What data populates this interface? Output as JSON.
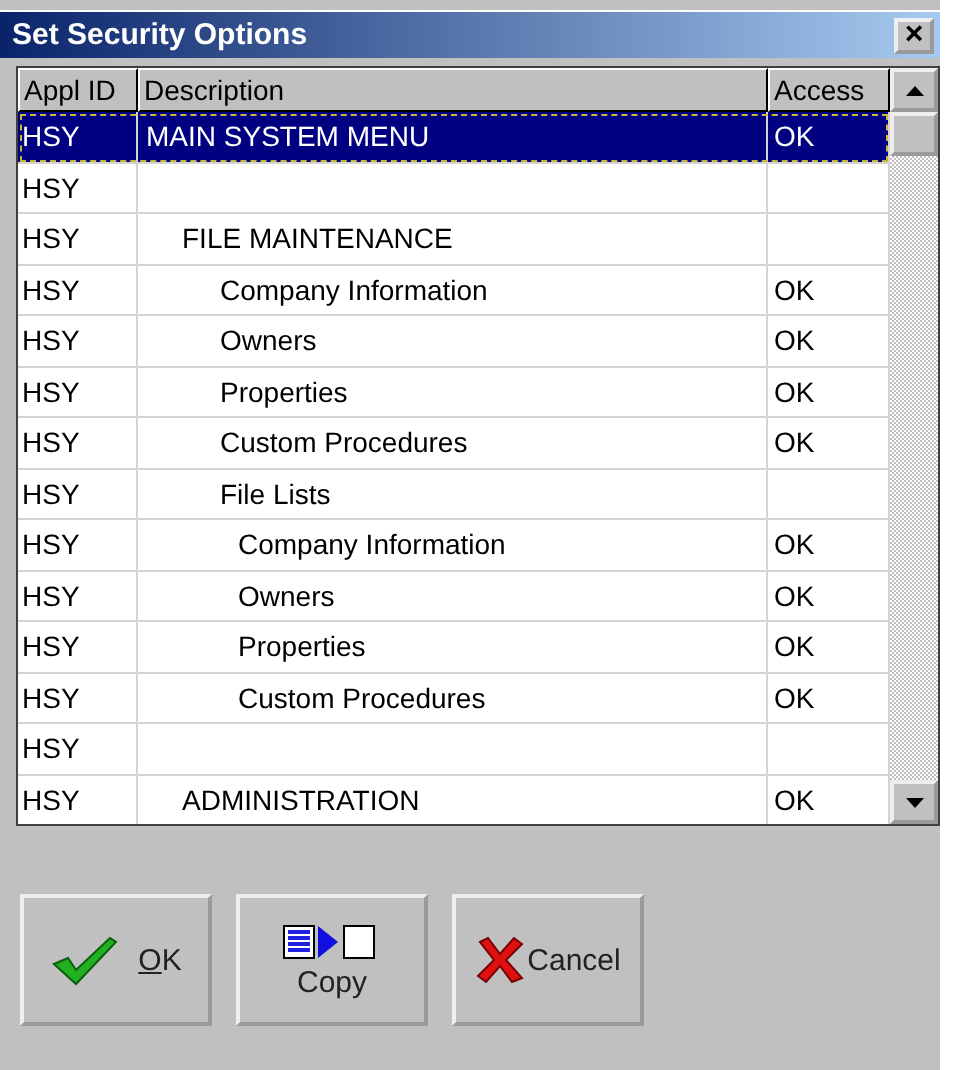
{
  "window": {
    "title": "Set Security Options",
    "close": "×"
  },
  "table": {
    "columns": [
      "Appl ID",
      "Description",
      "Access"
    ],
    "rows": [
      {
        "appl_id": "HSY",
        "description": "MAIN SYSTEM MENU",
        "access": "OK",
        "selected": true,
        "children": [
          {
            "appl_id": "HSY",
            "selected": false
          },
          {
            "appl_id": "HSY",
            "description": "FILE MAINTENANCE",
            "selected": false,
            "children": [
              {
                "appl_id": "HSY",
                "description": "Company Information",
                "access": "OK",
                "selected": false
              },
              {
                "appl_id": "HSY",
                "description": "Owners",
                "access": "OK",
                "selected": false
              },
              {
                "appl_id": "HSY",
                "description": "Properties",
                "access": "OK",
                "selected": false
              },
              {
                "appl_id": "HSY",
                "description": "Custom Procedures",
                "access": "OK",
                "selected": false
              },
              {
                "appl_id": "HSY",
                "description": "File Lists",
                "selected": false,
                "children": [
                  {
                    "appl_id": "HSY",
                    "description": "Company Information",
                    "access": "OK",
                    "selected": false
                  },
                  {
                    "appl_id": "HSY",
                    "description": "Owners",
                    "access": "OK",
                    "selected": false
                  },
                  {
                    "appl_id": "HSY",
                    "description": "Properties",
                    "access": "OK",
                    "selected": false
                  },
                  {
                    "appl_id": "HSY",
                    "description": "Custom Procedures",
                    "access": "OK",
                    "selected": false
                  }
                ]
              }
            ]
          },
          {
            "appl_id": "HSY",
            "selected": false
          },
          {
            "appl_id": "HSY",
            "description": "ADMINISTRATION",
            "access": "OK",
            "selected": false
          }
        ]
      }
    ]
  },
  "buttons": [
    {
      "kind": "ok",
      "label": "OK",
      "underline_first": true
    },
    {
      "kind": "copy",
      "label": "Copy"
    },
    {
      "kind": "cancel",
      "label": "Cancel"
    }
  ]
}
